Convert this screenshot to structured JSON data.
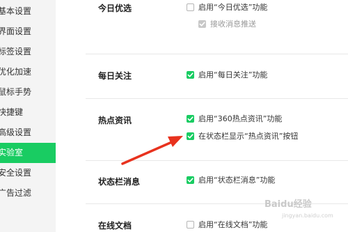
{
  "sidebar": {
    "items": [
      {
        "label": "基本设置",
        "active": false
      },
      {
        "label": "界面设置",
        "active": false
      },
      {
        "label": "标签设置",
        "active": false
      },
      {
        "label": "优化加速",
        "active": false
      },
      {
        "label": "鼠标手势",
        "active": false
      },
      {
        "label": "快捷键",
        "active": false
      },
      {
        "label": "高级设置",
        "active": false
      },
      {
        "label": "实验室",
        "active": true
      },
      {
        "label": "安全设置",
        "active": false
      },
      {
        "label": "广告过滤",
        "active": false
      }
    ]
  },
  "sections": {
    "today_pick": {
      "title": "今日优选",
      "opt_enable": {
        "label": "启用“今日优选”功能",
        "checked": false
      },
      "opt_receive": {
        "label": "接收消息推送",
        "checked": true,
        "disabled": true
      }
    },
    "daily_follow": {
      "title": "每日关注",
      "opt_enable": {
        "label": "启用“每日关注”功能",
        "checked": true
      }
    },
    "hot_news": {
      "title": "热点资讯",
      "opt_enable": {
        "label": "启用“360热点资讯”功能",
        "checked": true
      },
      "opt_statusbar_btn": {
        "label": "在状态栏显示“热点资讯”按钮",
        "checked": true
      }
    },
    "statusbar_msg": {
      "title": "状态栏消息",
      "opt_enable": {
        "label": "启用“状态栏消息”功能",
        "checked": true
      }
    },
    "online_docs": {
      "title": "在线文档",
      "opt_enable": {
        "label": "启用“在线文档”功能",
        "checked": false
      }
    }
  },
  "colors": {
    "accent": "#19cc62",
    "arrow": "#e8321e",
    "sidebar_bg": "#f4f4f4"
  },
  "watermark": {
    "text": "Baidu经验",
    "sub": "jingyan.baidu.com"
  }
}
